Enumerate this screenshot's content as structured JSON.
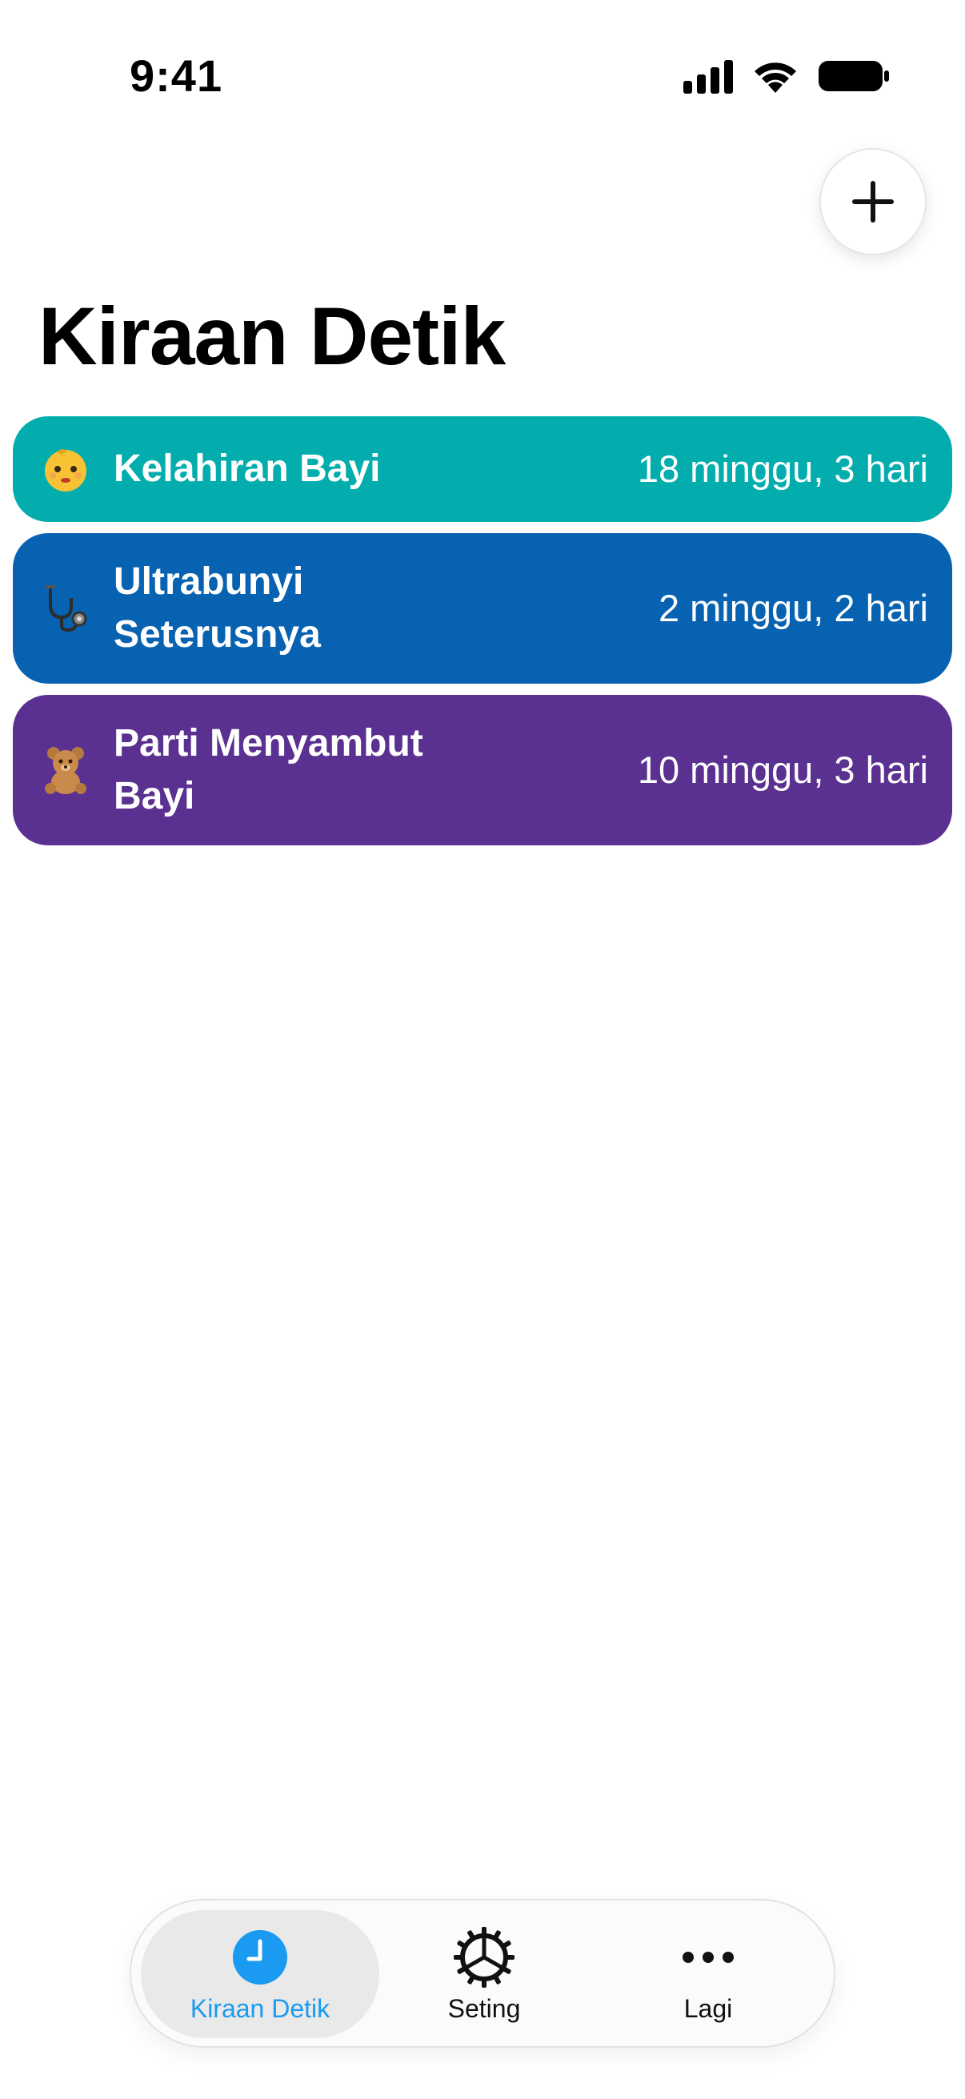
{
  "status_bar": {
    "time": "9:41"
  },
  "header": {
    "title": "Kiraan Detik",
    "add_button_icon": "plus-icon"
  },
  "countdowns": [
    {
      "emoji": "👶",
      "icon_name": "baby-icon",
      "label": "Kelahiran Bayi",
      "duration": "18 minggu, 3 hari",
      "color": "#04ADAD"
    },
    {
      "emoji": "🩺",
      "icon_name": "stethoscope-icon",
      "label": "Ultrabunyi Seterusnya",
      "duration": "2 minggu, 2 hari",
      "color": "#0762B1"
    },
    {
      "emoji": "🧸",
      "icon_name": "teddy-bear-icon",
      "label": "Parti Menyambut Bayi",
      "duration": "10 minggu, 3 hari",
      "color": "#5A3090"
    }
  ],
  "tab_bar": {
    "tabs": [
      {
        "label": "Kiraan Detik",
        "icon": "clock-icon",
        "active": true
      },
      {
        "label": "Seting",
        "icon": "gear-icon",
        "active": false
      },
      {
        "label": "Lagi",
        "icon": "more-icon",
        "active": false
      }
    ],
    "accent": "#1A9AF0"
  }
}
